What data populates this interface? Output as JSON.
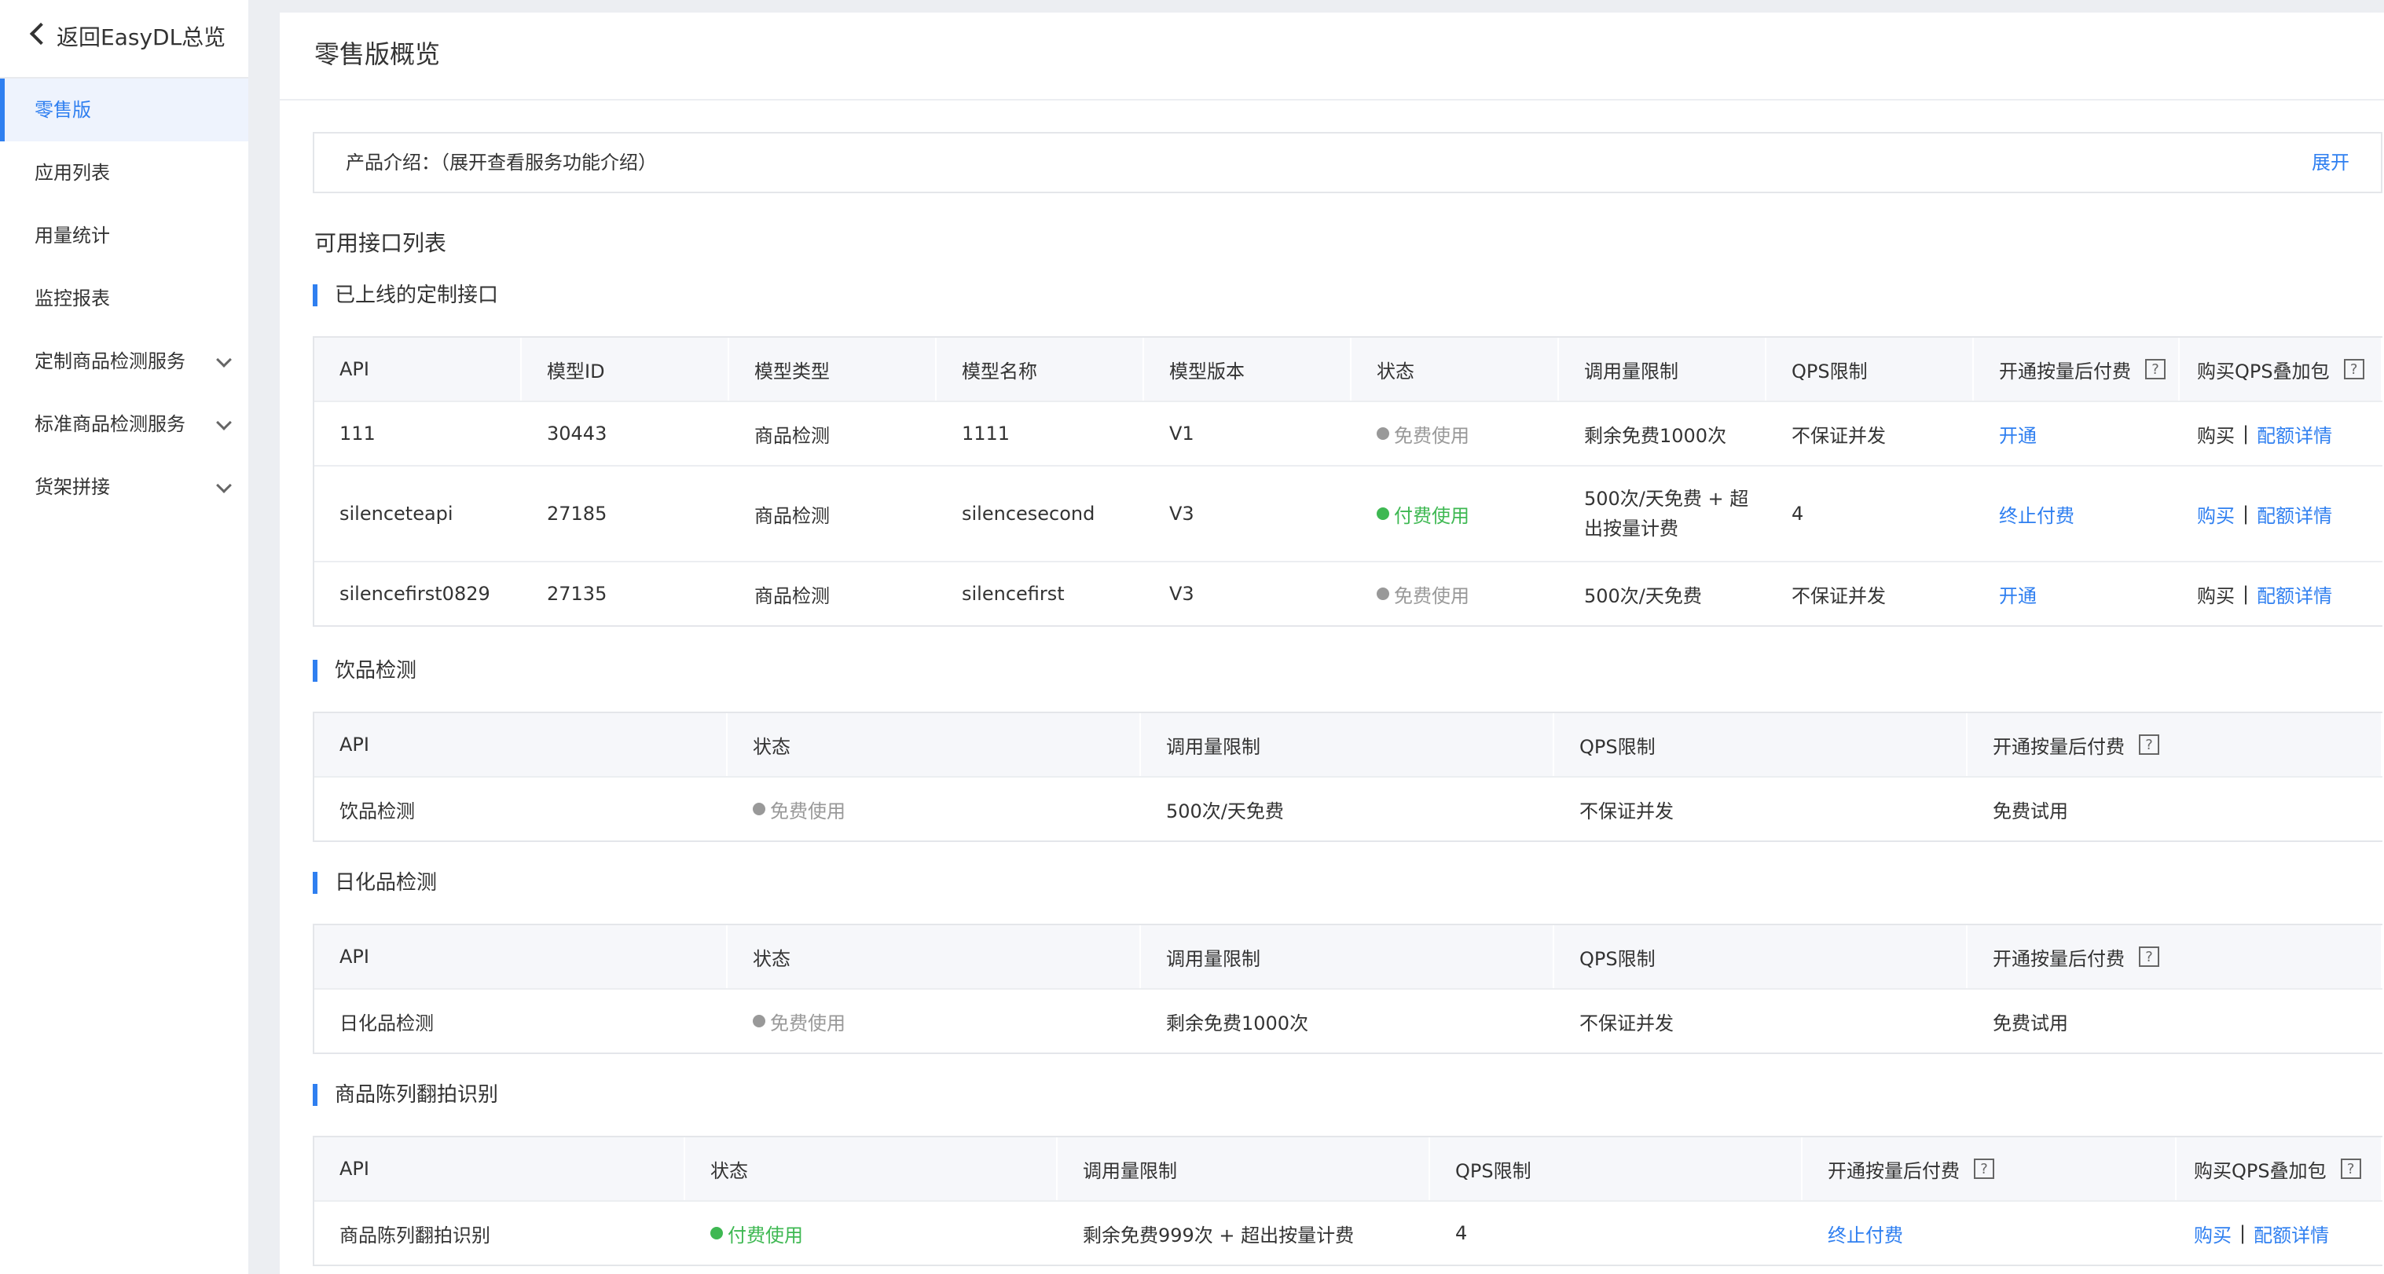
{
  "sidebar": {
    "back_label": "返回EasyDL总览",
    "items": [
      {
        "label": "零售版"
      },
      {
        "label": "应用列表"
      },
      {
        "label": "用量统计"
      },
      {
        "label": "监控报表"
      },
      {
        "label": "定制商品检测服务"
      },
      {
        "label": "标准商品检测服务"
      },
      {
        "label": "货架拼接"
      }
    ]
  },
  "page": {
    "title": "零售版概览",
    "intro_label": "产品介绍：（展开查看服务功能介绍）",
    "intro_expand": "展开",
    "list_title": "可用接口列表"
  },
  "sections": {
    "custom": {
      "title": "已上线的定制接口",
      "headers": [
        "API",
        "模型ID",
        "模型类型",
        "模型名称",
        "模型版本",
        "状态",
        "调用量限制",
        "QPS限制",
        "开通按量后付费",
        "购买QPS叠加包"
      ],
      "rows": [
        {
          "api": "111",
          "model_id": "30443",
          "model_type": "商品检测",
          "model_name": "1111",
          "version": "V1",
          "status": "免费使用",
          "limit": "剩余免费1000次",
          "qps": "不保证并发",
          "action": "开通",
          "buy": "购买",
          "quota": "配额详情"
        },
        {
          "api": "silenceteapi",
          "model_id": "27185",
          "model_type": "商品检测",
          "model_name": "silencesecond",
          "version": "V3",
          "status": "付费使用",
          "limit_line1": "500次/天免费 + 超",
          "limit_line2": "出按量计费",
          "qps": "4",
          "action": "终止付费",
          "buy": "购买",
          "quota": "配额详情"
        },
        {
          "api": "silencefirst0829",
          "model_id": "27135",
          "model_type": "商品检测",
          "model_name": "silencefirst",
          "version": "V3",
          "status": "免费使用",
          "limit": "500次/天免费",
          "qps": "不保证并发",
          "action": "开通",
          "buy": "购买",
          "quota": "配额详情"
        }
      ]
    },
    "drink": {
      "title": "饮品检测",
      "headers": [
        "API",
        "状态",
        "调用量限制",
        "QPS限制",
        "开通按量后付费"
      ],
      "row": {
        "api": "饮品检测",
        "status": "免费使用",
        "limit": "500次/天免费",
        "qps": "不保证并发",
        "action": "免费试用"
      }
    },
    "daily": {
      "title": "日化品检测",
      "headers": [
        "API",
        "状态",
        "调用量限制",
        "QPS限制",
        "开通按量后付费"
      ],
      "row": {
        "api": "日化品检测",
        "status": "免费使用",
        "limit": "剩余免费1000次",
        "qps": "不保证并发",
        "action": "免费试用"
      }
    },
    "display": {
      "title": "商品陈列翻拍识别",
      "headers": [
        "API",
        "状态",
        "调用量限制",
        "QPS限制",
        "开通按量后付费",
        "购买QPS叠加包"
      ],
      "row": {
        "api": "商品陈列翻拍识别",
        "status": "付费使用",
        "limit": "剩余免费999次 + 超出按量计费",
        "qps": "4",
        "action": "终止付费",
        "buy": "购买",
        "quota": "配额详情"
      }
    }
  },
  "help_mark": "?",
  "separator": "|",
  "colors": {
    "accent": "#2f7ff0",
    "paid": "#3eb852",
    "free": "#999999"
  }
}
